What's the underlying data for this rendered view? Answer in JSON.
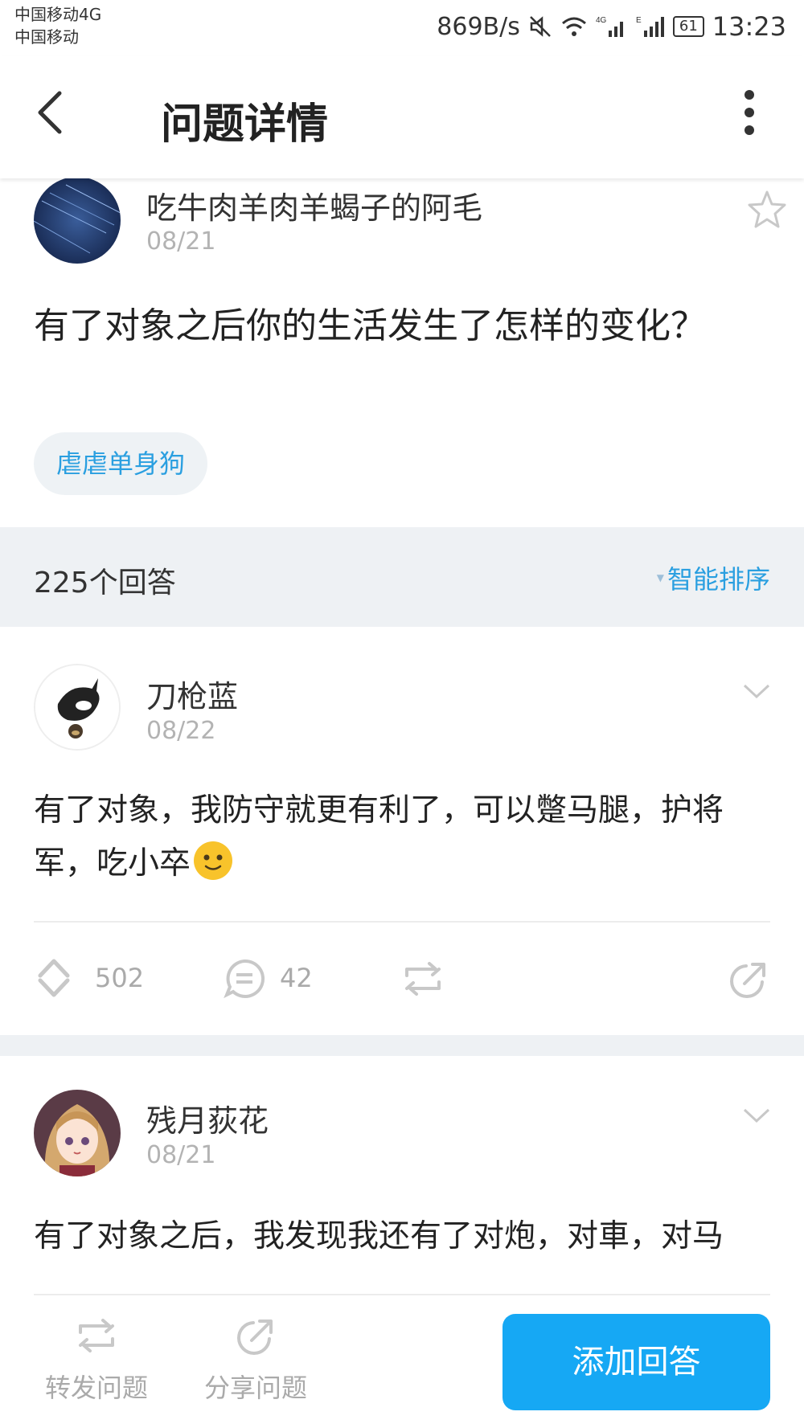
{
  "status_bar": {
    "carrier_1": "中国移动4G",
    "carrier_2": "中国移动",
    "speed": "869B/s",
    "battery": "61",
    "time": "13:23"
  },
  "header": {
    "title": "问题详情"
  },
  "question": {
    "author": "吃牛肉羊肉羊蝎子的阿毛",
    "date": "08/21",
    "text": "有了对象之后你的生活发生了怎样的变化？",
    "tag": "虐虐单身狗"
  },
  "answers_header": {
    "count_label": "225个回答",
    "sort_label": "智能排序"
  },
  "answers": [
    {
      "author": "刀枪蓝",
      "date": "08/22",
      "text": "有了对象，我防守就更有利了，可以蹩马腿，护将军，吃小卒",
      "upvotes": "502",
      "comments": "42"
    },
    {
      "author": "残月荻花",
      "date": "08/21",
      "text": "有了对象之后，我发现我还有了对炮，对車，对马"
    }
  ],
  "bottom_bar": {
    "repost_label": "转发问题",
    "share_label": "分享问题",
    "add_answer_label": "添加回答"
  },
  "colors": {
    "accent": "#16a8f4",
    "tag_text": "#2a9fe0",
    "band": "#eef1f4"
  }
}
